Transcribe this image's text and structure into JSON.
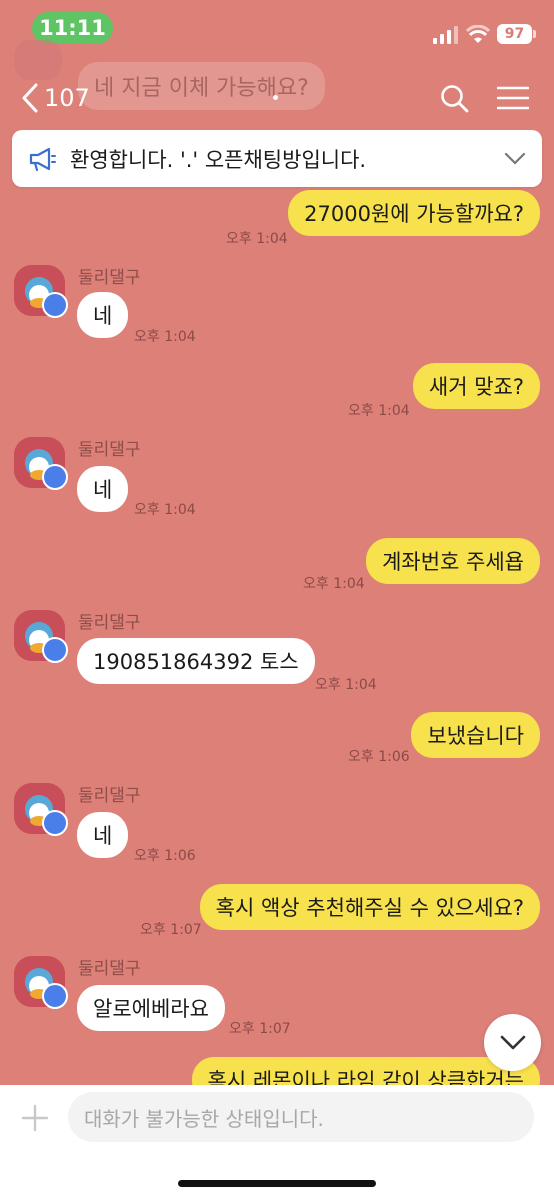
{
  "status_bar": {
    "time": "11:11",
    "battery": "97"
  },
  "header": {
    "back_count": "107",
    "ghost_message": "네 지금 이체 가능해요?"
  },
  "notice": {
    "text": "환영합니다. '.' 오픈채팅방입니다."
  },
  "messages": [
    {
      "from": "me",
      "text": "27000원에 가능할까요?",
      "time": "오후 1:04"
    },
    {
      "from": "them",
      "sender": "둘리댈구",
      "text": "네",
      "time": "오후 1:04"
    },
    {
      "from": "me",
      "text": "새거 맞죠?",
      "time": "오후 1:04"
    },
    {
      "from": "them",
      "sender": "둘리댈구",
      "text": "네",
      "time": "오후 1:04"
    },
    {
      "from": "me",
      "text": "계좌번호 주세욥",
      "time": "오후 1:04"
    },
    {
      "from": "them",
      "sender": "둘리댈구",
      "text": "190851864392 토스",
      "time": "오후 1:04"
    },
    {
      "from": "me",
      "text": "보냈습니다",
      "time": "오후 1:06"
    },
    {
      "from": "them",
      "sender": "둘리댈구",
      "text": "네",
      "time": "오후 1:06"
    },
    {
      "from": "me",
      "text": "혹시 액상 추천해주실 수 있으세요?",
      "time": "오후 1:07"
    },
    {
      "from": "them",
      "sender": "둘리댈구",
      "text": "알로에베라요",
      "time": "오후 1:07"
    },
    {
      "from": "me",
      "text": "혹시 레몬이나 라임 같이 상큼한거는",
      "time": ""
    }
  ],
  "input": {
    "placeholder": "대화가 불가능한 상태입니다."
  },
  "icons": {
    "megaphone": "megaphone-icon",
    "search": "search-icon",
    "menu": "hamburger-menu-icon",
    "back": "chevron-left-icon",
    "scroll": "chevron-down-icon",
    "plus": "plus-icon"
  },
  "colors": {
    "background": "#dc8078",
    "my_bubble": "#f7e14c",
    "their_bubble": "#ffffff",
    "time_pill": "#5fc464"
  }
}
